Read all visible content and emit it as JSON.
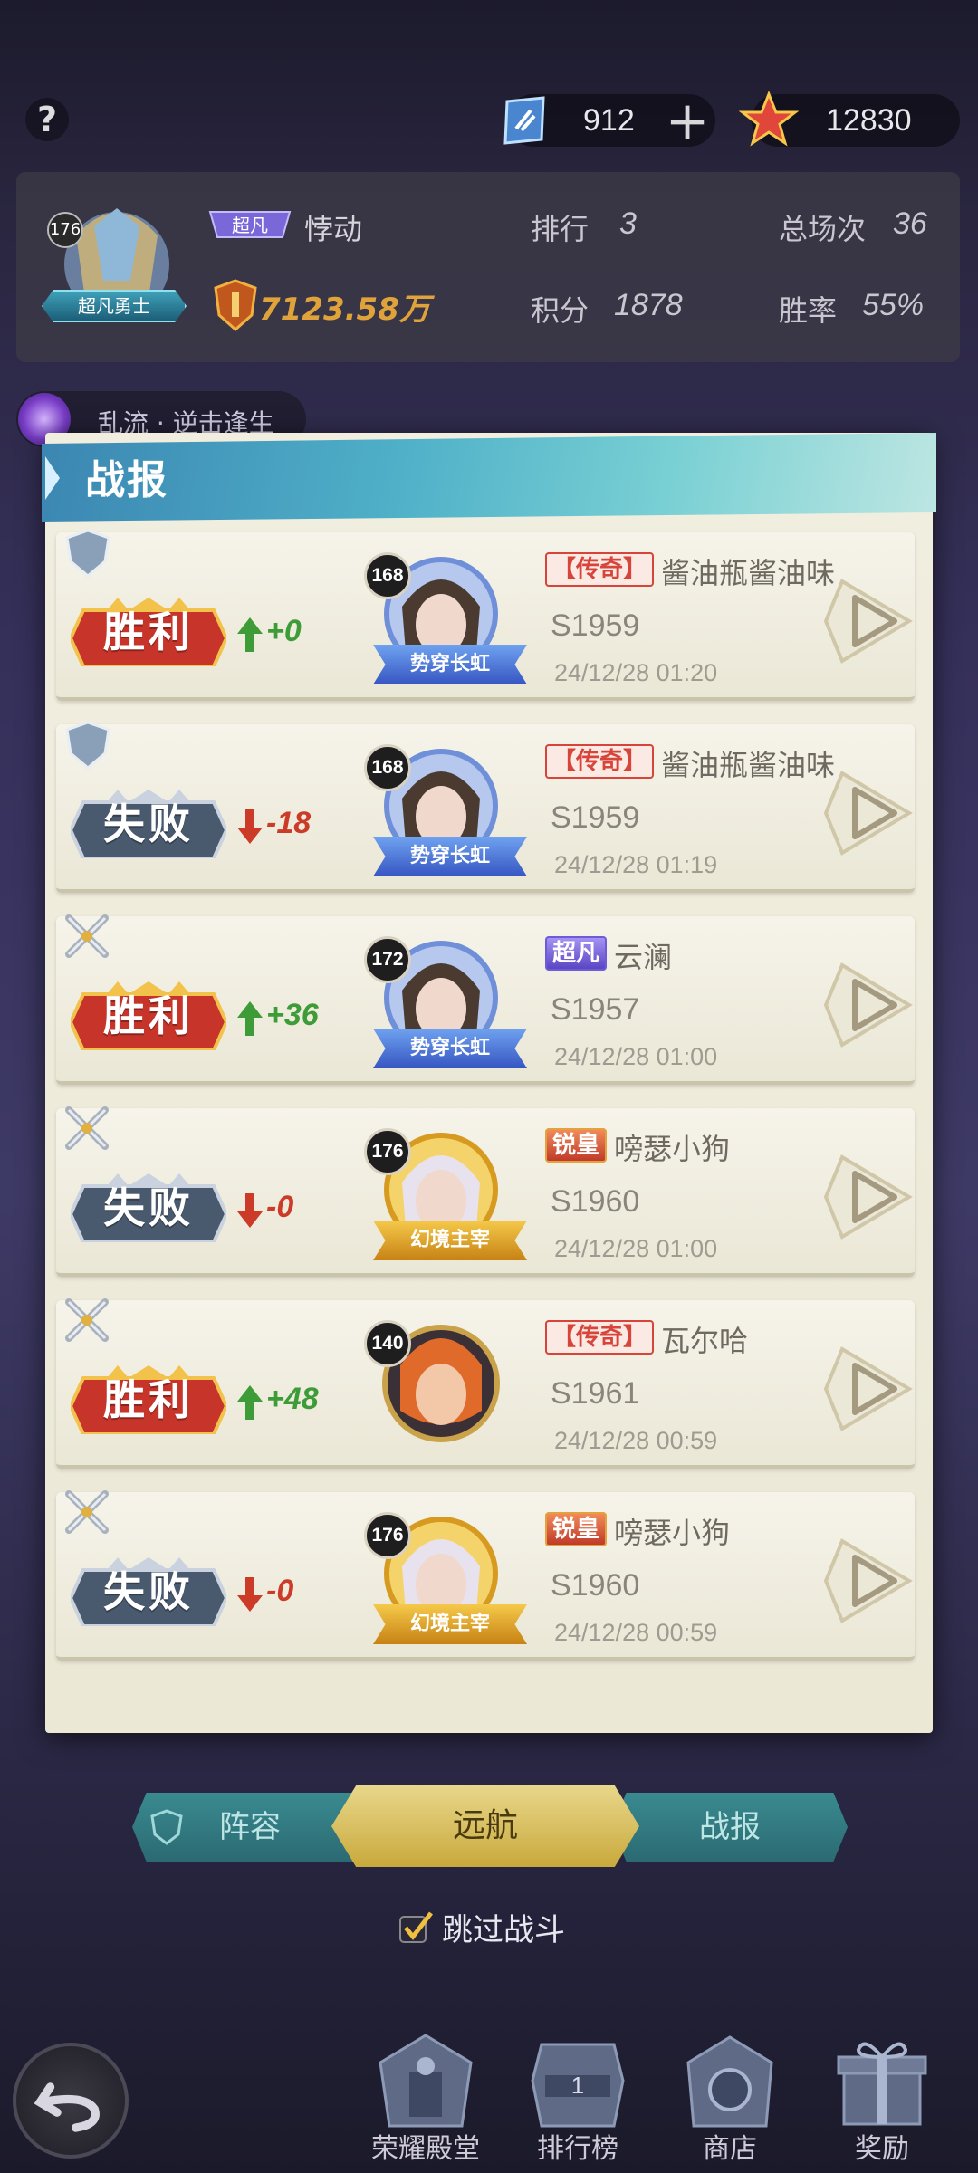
{
  "top_bar": {
    "help_label": "?",
    "currency_tickets": "912",
    "currency_add_label": "+",
    "currency_points": "12830"
  },
  "profile": {
    "level": "176",
    "title": "超凡勇士",
    "rank_badge": "超凡",
    "name": "悖动",
    "power": "7123.58万",
    "rank_label": "排行",
    "rank_value": "3",
    "matches_label": "总场次",
    "matches_value": "36",
    "score_label": "积分",
    "score_value": "1878",
    "winrate_label": "胜率",
    "winrate_value": "55%"
  },
  "mode": {
    "label": "乱流 · 逆击逢生"
  },
  "report": {
    "title": "战报",
    "entries": [
      {
        "mode_icon": "shield-icon",
        "result": "胜利",
        "won": true,
        "delta": "+0",
        "hero_level": "168",
        "hero_banner": "势穿长虹",
        "banner": "blue",
        "opp_tag": "【传奇】",
        "opp_tag_type": "legend",
        "opp_name": "酱油瓶酱油味",
        "server": "S1959",
        "time": "24/12/28 01:20"
      },
      {
        "mode_icon": "shield-icon",
        "result": "失败",
        "won": false,
        "delta": "-18",
        "hero_level": "168",
        "hero_banner": "势穿长虹",
        "banner": "blue",
        "opp_tag": "【传奇】",
        "opp_tag_type": "legend",
        "opp_name": "酱油瓶酱油味",
        "server": "S1959",
        "time": "24/12/28 01:19"
      },
      {
        "mode_icon": "swords-icon",
        "result": "胜利",
        "won": true,
        "delta": "+36",
        "hero_level": "172",
        "hero_banner": "势穿长虹",
        "banner": "blue",
        "opp_tag": "超凡",
        "opp_tag_type": "super",
        "opp_name": "云澜",
        "server": "S1957",
        "time": "24/12/28 01:00"
      },
      {
        "mode_icon": "swords-icon",
        "result": "失败",
        "won": false,
        "delta": "-0",
        "hero_level": "176",
        "hero_banner": "幻境主宰",
        "banner": "gold",
        "opp_tag": "锐皇",
        "opp_tag_type": "king",
        "opp_name": "嗙瑟小狗",
        "server": "S1960",
        "time": "24/12/28 01:00"
      },
      {
        "mode_icon": "swords-icon",
        "result": "胜利",
        "won": true,
        "delta": "+48",
        "hero_level": "140",
        "hero_banner": "",
        "banner": "none",
        "opp_tag": "【传奇】",
        "opp_tag_type": "legend",
        "opp_name": "瓦尔哈",
        "server": "S1961",
        "time": "24/12/28 00:59"
      },
      {
        "mode_icon": "swords-icon",
        "result": "失败",
        "won": false,
        "delta": "-0",
        "hero_level": "176",
        "hero_banner": "幻境主宰",
        "banner": "gold",
        "opp_tag": "锐皇",
        "opp_tag_type": "king",
        "opp_name": "嗙瑟小狗",
        "server": "S1960",
        "time": "24/12/28 00:59"
      }
    ]
  },
  "tabs": {
    "lineup": "阵容",
    "voyage": "远航",
    "report": "战报"
  },
  "skip_battle": "跳过战斗",
  "bottom_nav": {
    "hall_of_fame": "荣耀殿堂",
    "leaderboard": "排行榜",
    "shop": "商店",
    "rewards": "奖励",
    "leaderboard_icon_text": "1"
  },
  "colors": {
    "win_red": "#c7342a",
    "loss_slate": "#4a5a6e",
    "delta_up": "#3e9c38",
    "delta_down": "#cc3a28",
    "header_teal": "#4fb0c8",
    "power_gold": "#e0a23a"
  }
}
